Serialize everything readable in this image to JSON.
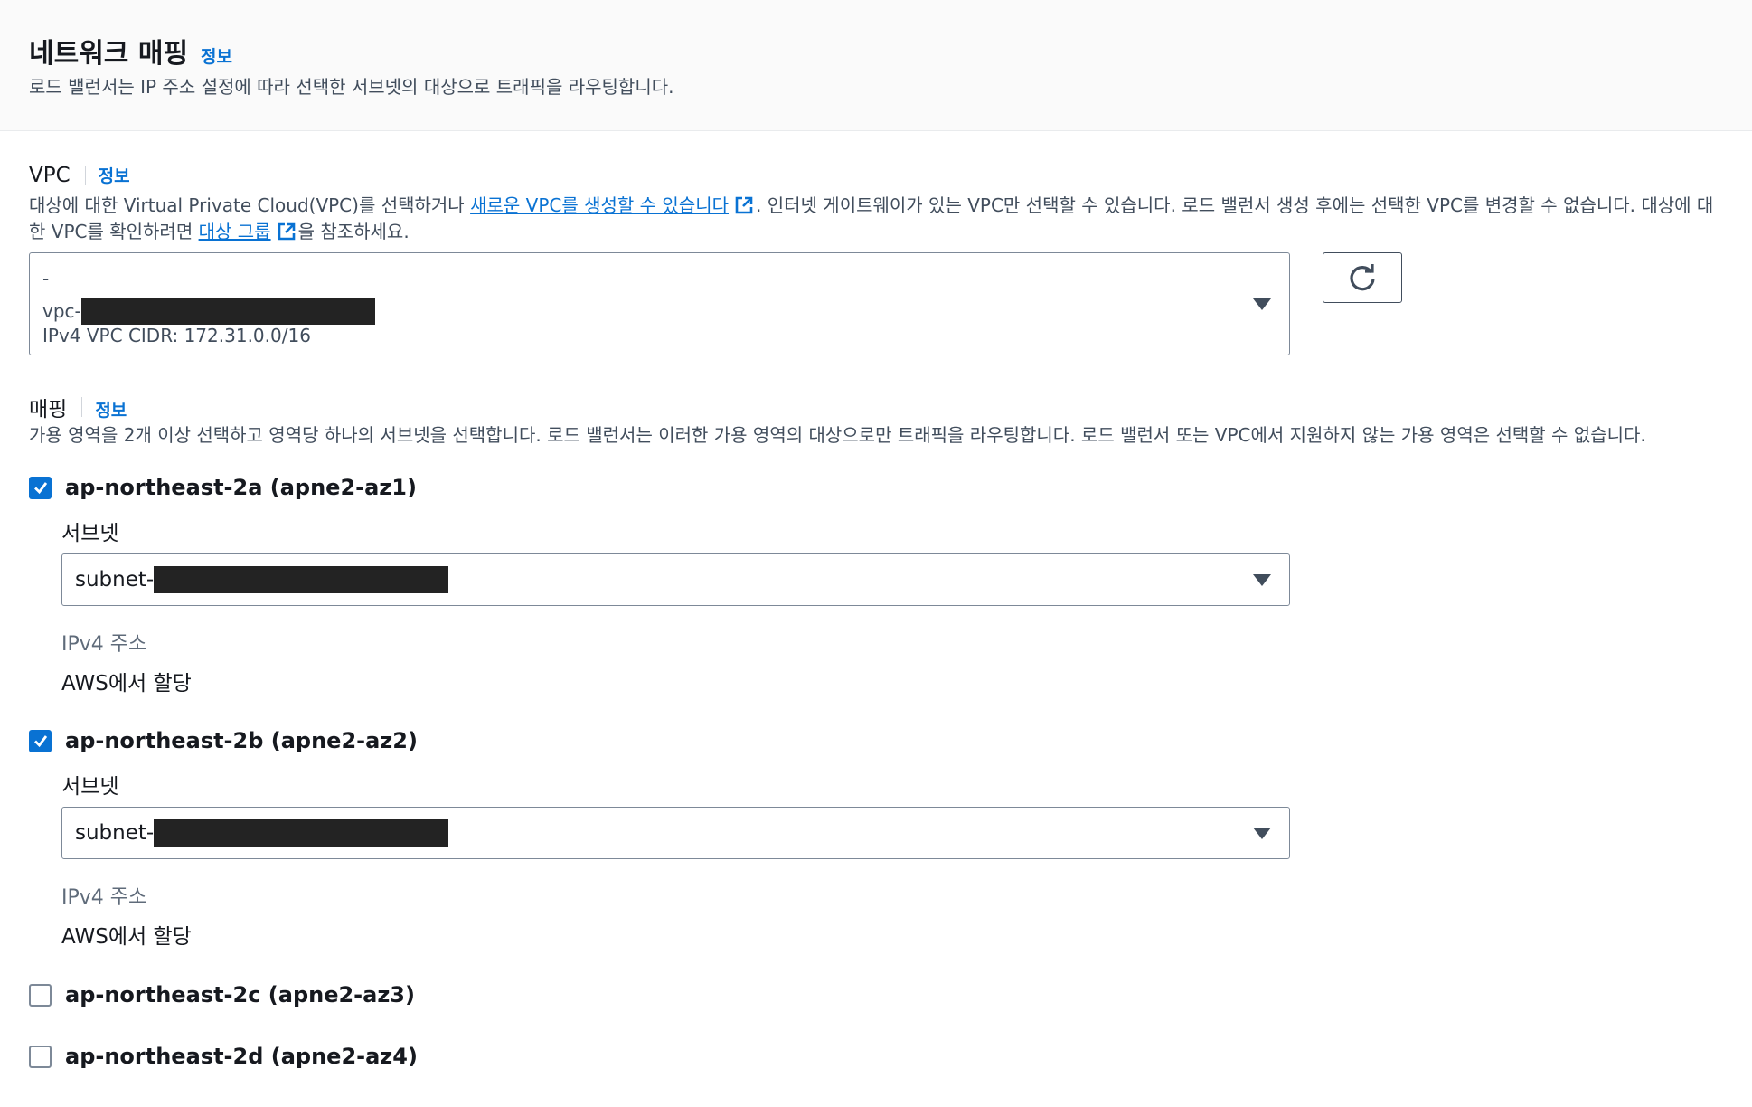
{
  "header": {
    "title": "네트워크 매핑",
    "info": "정보",
    "description": "로드 밸런서는 IP 주소 설정에 따라 선택한 서브넷의 대상으로 트래픽을 라우팅합니다."
  },
  "vpc": {
    "label": "VPC",
    "info": "정보",
    "desc_part1": "대상에 대한 Virtual Private Cloud(VPC)를 선택하거나 ",
    "create_link": "새로운 VPC를 생성할 수 있습니다",
    "desc_part2": ". 인터넷 게이트웨이가 있는 VPC만 선택할 수 있습니다. 로드 밸런서 생성 후에는 선택한 VPC를 변경할 수 없습니다. 대상에 대",
    "desc_part3": "한 VPC를 확인하려면 ",
    "target_group_link": "대상 그룹",
    "desc_part4": "을 참조하세요.",
    "selected_name": "-",
    "selected_id_prefix": "vpc-",
    "selected_cidr": "IPv4 VPC CIDR: 172.31.0.0/16"
  },
  "mapping": {
    "label": "매핑",
    "info": "정보",
    "description": "가용 영역을 2개 이상 선택하고 영역당 하나의 서브넷을 선택합니다. 로드 밸런서는 이러한 가용 영역의 대상으로만 트래픽을 라우팅합니다. 로드 밸런서 또는 VPC에서 지원하지 않는 가용 영역은 선택할 수 없습니다.",
    "zones": [
      {
        "name": "ap-northeast-2a (apne2-az1)",
        "checked": true,
        "subnet_label": "서브넷",
        "subnet_prefix": "subnet-",
        "ip_label": "IPv4 주소",
        "ip_value": "AWS에서 할당"
      },
      {
        "name": "ap-northeast-2b (apne2-az2)",
        "checked": true,
        "subnet_label": "서브넷",
        "subnet_prefix": "subnet-",
        "ip_label": "IPv4 주소",
        "ip_value": "AWS에서 할당"
      },
      {
        "name": "ap-northeast-2c (apne2-az3)",
        "checked": false
      },
      {
        "name": "ap-northeast-2d (apne2-az4)",
        "checked": false
      }
    ]
  },
  "icons": {
    "refresh": "refresh-icon",
    "external": "external-link-icon",
    "dropdown": "caret-down-icon",
    "check": "check-icon"
  },
  "colors": {
    "link": "#0972d3",
    "checkbox_checked": "#0972d3",
    "redaction": "#232323"
  }
}
